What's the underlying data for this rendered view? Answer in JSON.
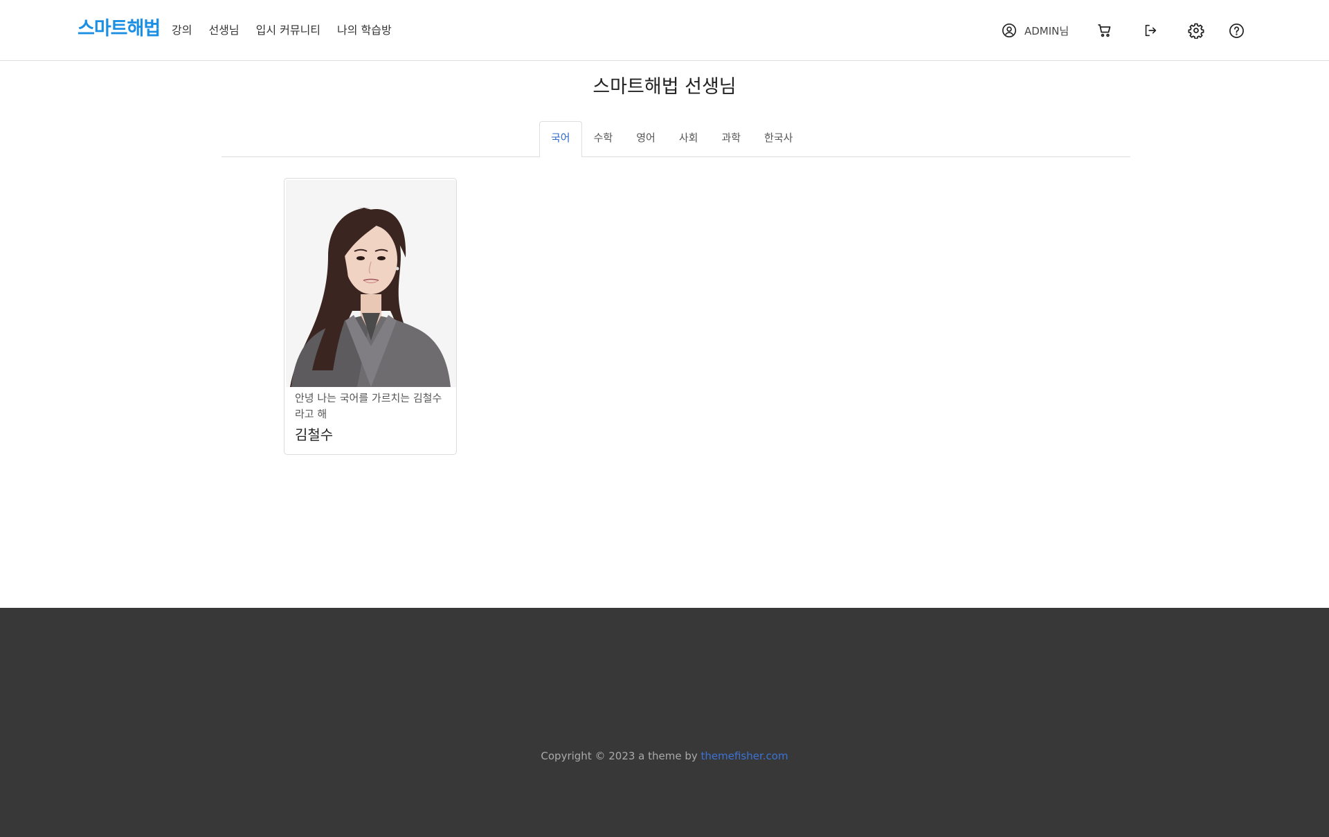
{
  "header": {
    "logo": "스마트해법",
    "nav": [
      {
        "label": "강의"
      },
      {
        "label": "선생님"
      },
      {
        "label": "입시 커뮤니티"
      },
      {
        "label": "나의 학습방"
      }
    ],
    "user_label": "ADMIN님",
    "icons": [
      "user-circle-icon",
      "cart-icon",
      "logout-icon",
      "gear-icon",
      "help-icon"
    ]
  },
  "page": {
    "title": "스마트해법 선생님"
  },
  "tabs": [
    {
      "label": "국어",
      "active": true
    },
    {
      "label": "수학",
      "active": false
    },
    {
      "label": "영어",
      "active": false
    },
    {
      "label": "사회",
      "active": false
    },
    {
      "label": "과학",
      "active": false
    },
    {
      "label": "한국사",
      "active": false
    }
  ],
  "teachers": [
    {
      "description": "안녕 나는 국어를 가르치는 김철수 라고 해",
      "name": "김철수"
    }
  ],
  "footer": {
    "copyright_prefix": "Copyright © 2023 a theme by ",
    "link_text": "themefisher.com"
  },
  "colors": {
    "brand": "#1a8fe3",
    "active_tab": "#2f69c9",
    "footer_bg": "#383838",
    "footer_link": "#3b73d6"
  }
}
